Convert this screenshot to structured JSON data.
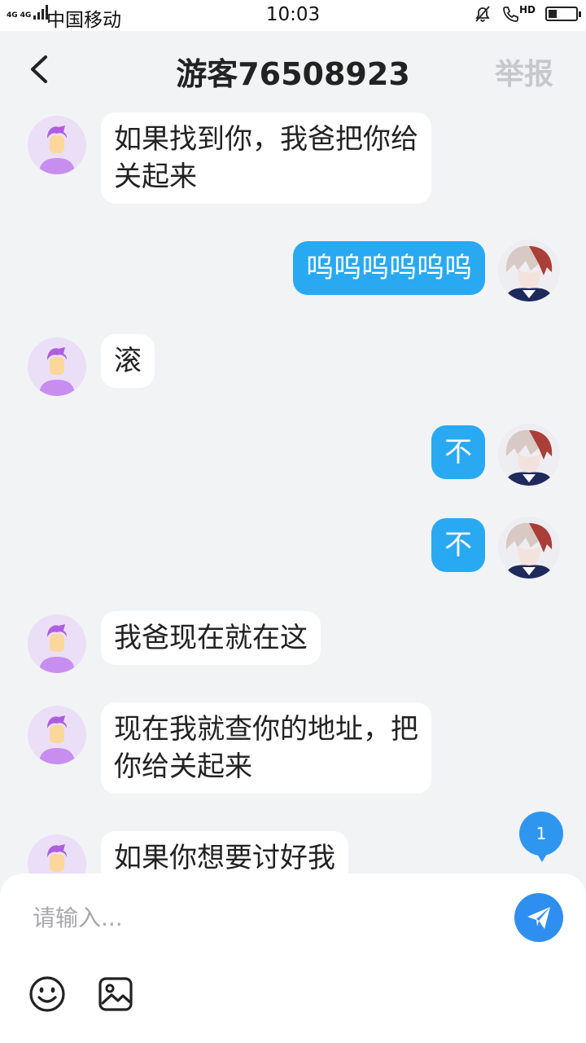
{
  "status_bar": {
    "network_left": "4G",
    "network_right": "4G",
    "carrier": "中国移动",
    "time": "10:03",
    "hd_label": "HD",
    "icons": [
      "signal-icon",
      "mute-bell-icon",
      "hd-call-icon",
      "battery-icon"
    ]
  },
  "header": {
    "title": "游客76508923",
    "report_label": "举报",
    "back_icon": "chevron-left-icon"
  },
  "messages": [
    {
      "side": "left",
      "lines": [
        "如果找到你，我爸把你给",
        "关起来"
      ]
    },
    {
      "side": "right",
      "lines": [
        "呜呜呜呜呜呜"
      ]
    },
    {
      "side": "left",
      "lines": [
        "滚"
      ]
    },
    {
      "side": "right",
      "lines": [
        "不"
      ]
    },
    {
      "side": "right",
      "lines": [
        "不"
      ]
    },
    {
      "side": "left",
      "lines": [
        "我爸现在就在这"
      ]
    },
    {
      "side": "left",
      "lines": [
        "现在我就查你的地址，把",
        "你给关起来"
      ]
    },
    {
      "side": "left",
      "lines": [
        "如果你想要讨好我"
      ]
    }
  ],
  "unread_count": "1",
  "input": {
    "placeholder": "请输入...",
    "value": ""
  },
  "toolbar_icons": [
    "send-icon",
    "emoji-icon",
    "image-icon"
  ],
  "colors": {
    "accent": "#2f8ff0",
    "outgoing_bubble": "#29a9f2",
    "incoming_bubble": "#ffffff",
    "background": "#f2f3f5",
    "avatar_left_bg": "#ebdff7",
    "avatar_hair": "#b05ee0",
    "avatar_face": "#fbd79c"
  }
}
